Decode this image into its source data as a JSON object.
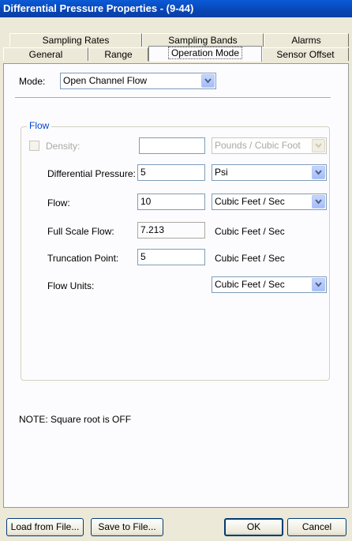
{
  "window": {
    "title": "Differential Pressure Properties -  (9-44)"
  },
  "tabs": {
    "row1": [
      "Sampling Rates",
      "Sampling Bands",
      "Alarms"
    ],
    "row2": [
      "General",
      "Range",
      "Operation Mode",
      "Sensor Offset"
    ],
    "active": "Operation Mode"
  },
  "mode": {
    "label": "Mode:",
    "value": "Open Channel Flow"
  },
  "flow_group": {
    "title": "Flow",
    "density": {
      "label": "Density:",
      "value": "",
      "unit": "Pounds / Cubic Foot",
      "checked": false,
      "enabled": false
    },
    "diff_pressure": {
      "label": "Differential Pressure:",
      "value": "5",
      "unit": "Psi"
    },
    "flow": {
      "label": "Flow:",
      "value": "10",
      "unit": "Cubic Feet / Sec"
    },
    "full_scale_flow": {
      "label": "Full Scale Flow:",
      "value": "7.213",
      "unit": "Cubic Feet / Sec"
    },
    "truncation_point": {
      "label": "Truncation Point:",
      "value": "5",
      "unit": "Cubic Feet / Sec"
    },
    "flow_units": {
      "label": "Flow Units:",
      "value": "Cubic Feet / Sec"
    }
  },
  "note": "NOTE: Square root is OFF",
  "buttons": {
    "load": "Load from File...",
    "save": "Save to File...",
    "ok": "OK",
    "cancel": "Cancel"
  },
  "icons": {
    "dropdown": "chevron-down-icon",
    "checkbox": "checkbox-icon"
  },
  "colors": {
    "title_bar": "#0846b6",
    "group_title": "#0046d5",
    "panel": "#fcfcfe",
    "dialog": "#ece9d8"
  }
}
